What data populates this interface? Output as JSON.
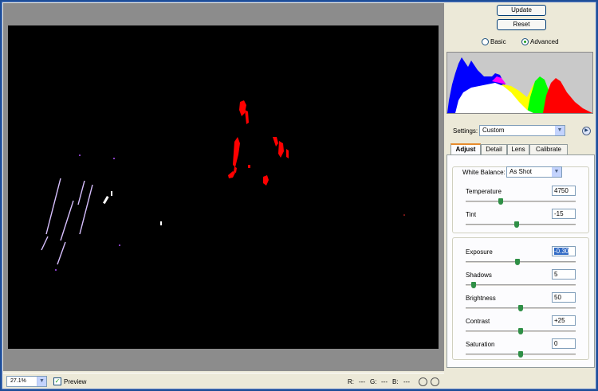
{
  "buttons": {
    "update": "Update",
    "reset": "Reset"
  },
  "mode": {
    "basic": "Basic",
    "advanced": "Advanced",
    "selected": "Advanced"
  },
  "settings": {
    "label": "Settings:",
    "value": "Custom"
  },
  "tabs": [
    {
      "label": "Adjust",
      "active": true
    },
    {
      "label": "Detail",
      "active": false
    },
    {
      "label": "Lens",
      "active": false
    },
    {
      "label": "Calibrate",
      "active": false
    }
  ],
  "white_balance": {
    "label": "White Balance:",
    "value": "As Shot"
  },
  "adjust": {
    "temperature": {
      "label": "Temperature",
      "value": "4750",
      "level": 0.31
    },
    "tint": {
      "label": "Tint",
      "value": "-15",
      "level": 0.46
    },
    "exposure": {
      "label": "Exposure",
      "value": "-0.30",
      "level": 0.47
    },
    "shadows": {
      "label": "Shadows",
      "value": "5",
      "level": 0.05
    },
    "brightness": {
      "label": "Brightness",
      "value": "50",
      "level": 0.5
    },
    "contrast": {
      "label": "Contrast",
      "value": "+25",
      "level": 0.5
    },
    "saturation": {
      "label": "Saturation",
      "value": "0",
      "level": 0.5
    }
  },
  "bottom": {
    "zoom": "27.1%",
    "preview_label": "Preview",
    "preview_checked": true,
    "r": "R:",
    "r_val": "---",
    "g": "G:",
    "g_val": "---",
    "b": "B:",
    "b_val": "---"
  },
  "icons": {
    "rotate_left": "rotate-left-icon",
    "rotate_right": "rotate-right-icon",
    "settings_menu": "flyout-menu-icon"
  }
}
